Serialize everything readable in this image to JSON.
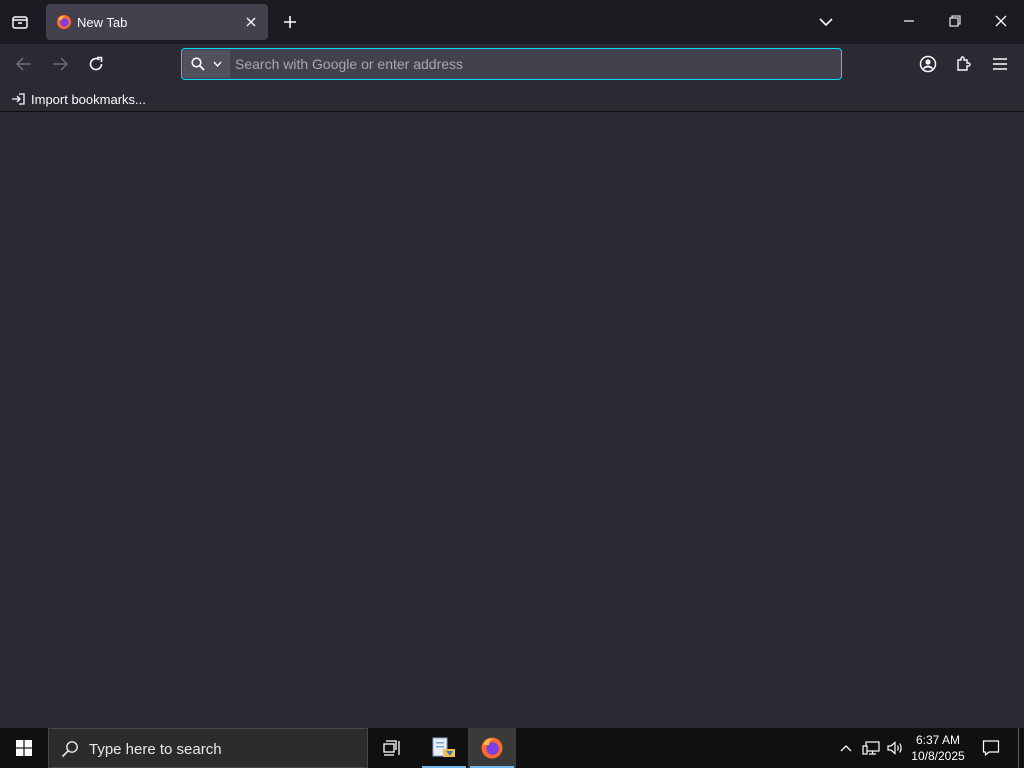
{
  "browser": {
    "tabs": [
      {
        "title": "New Tab"
      }
    ],
    "urlbar": {
      "placeholder": "Search with Google or enter address",
      "value": ""
    },
    "bookmarks_toolbar": {
      "import_label": "Import bookmarks..."
    }
  },
  "taskbar": {
    "search_placeholder": "Type here to search",
    "clock": {
      "time": "6:37 AM",
      "date": "10/8/2025"
    },
    "apps": [
      {
        "icon": "file-explorer-icon",
        "active": true
      },
      {
        "icon": "firefox-icon",
        "active": true
      }
    ]
  },
  "colors": {
    "tabbar_bg": "#1c1b22",
    "toolbar_bg": "#2b2a33",
    "active_tab_bg": "#42414d",
    "focus_ring": "#00ddff",
    "taskbar_bg": "#101010",
    "taskbar_accent": "#76b9ed"
  }
}
